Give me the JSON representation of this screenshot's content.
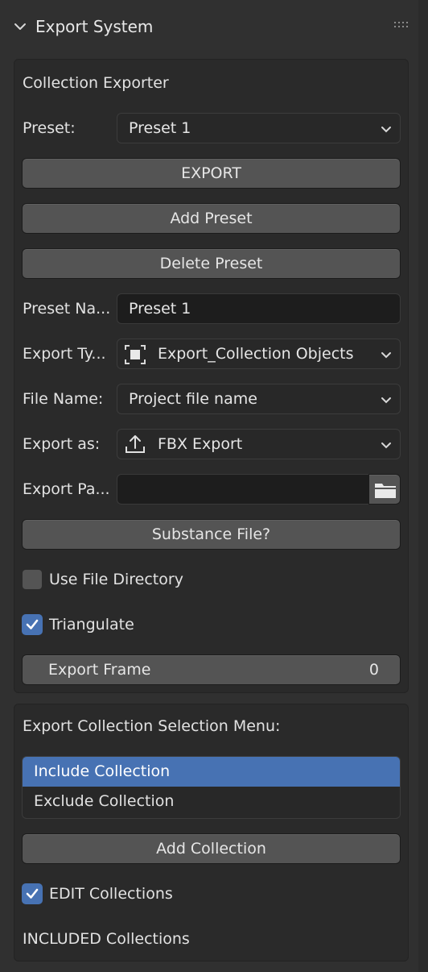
{
  "header": {
    "title": "Export System"
  },
  "panel1": {
    "title": "Collection Exporter",
    "preset_label": "Preset:",
    "preset_value": "Preset 1",
    "export_button": "EXPORT",
    "add_preset_button": "Add Preset",
    "delete_preset_button": "Delete Preset",
    "preset_name_label": "Preset Na...",
    "preset_name_value": "Preset 1",
    "export_type_label": "Export Ty...",
    "export_type_value": "Export_Collection Objects",
    "file_name_label": "File Name:",
    "file_name_value": "Project file name",
    "export_as_label": "Export as:",
    "export_as_value": "FBX Export",
    "export_path_label": "Export Pa...",
    "export_path_value": "",
    "substance_button": "Substance File?",
    "use_file_directory": {
      "label": "Use File Directory",
      "checked": false
    },
    "triangulate": {
      "label": "Triangulate",
      "checked": true
    },
    "export_frame": {
      "label": "Export Frame",
      "value": "0"
    }
  },
  "panel2": {
    "title": "Export Collection Selection Menu:",
    "list": [
      "Include Collection",
      "Exclude Collection"
    ],
    "selected_index": 0,
    "add_collection_button": "Add Collection",
    "edit_collections": {
      "label": "EDIT Collections",
      "checked": true
    },
    "included_label": "INCLUDED Collections"
  },
  "colors": {
    "accent": "#4772b3",
    "button": "#545454",
    "panel": "#2a2a2a",
    "background": "#303030"
  },
  "icons": [
    "chevron-down-icon",
    "grip-icon",
    "dropdown-arrow-icon",
    "collection-square-icon",
    "export-upload-icon",
    "folder-icon",
    "checkmark-icon"
  ]
}
